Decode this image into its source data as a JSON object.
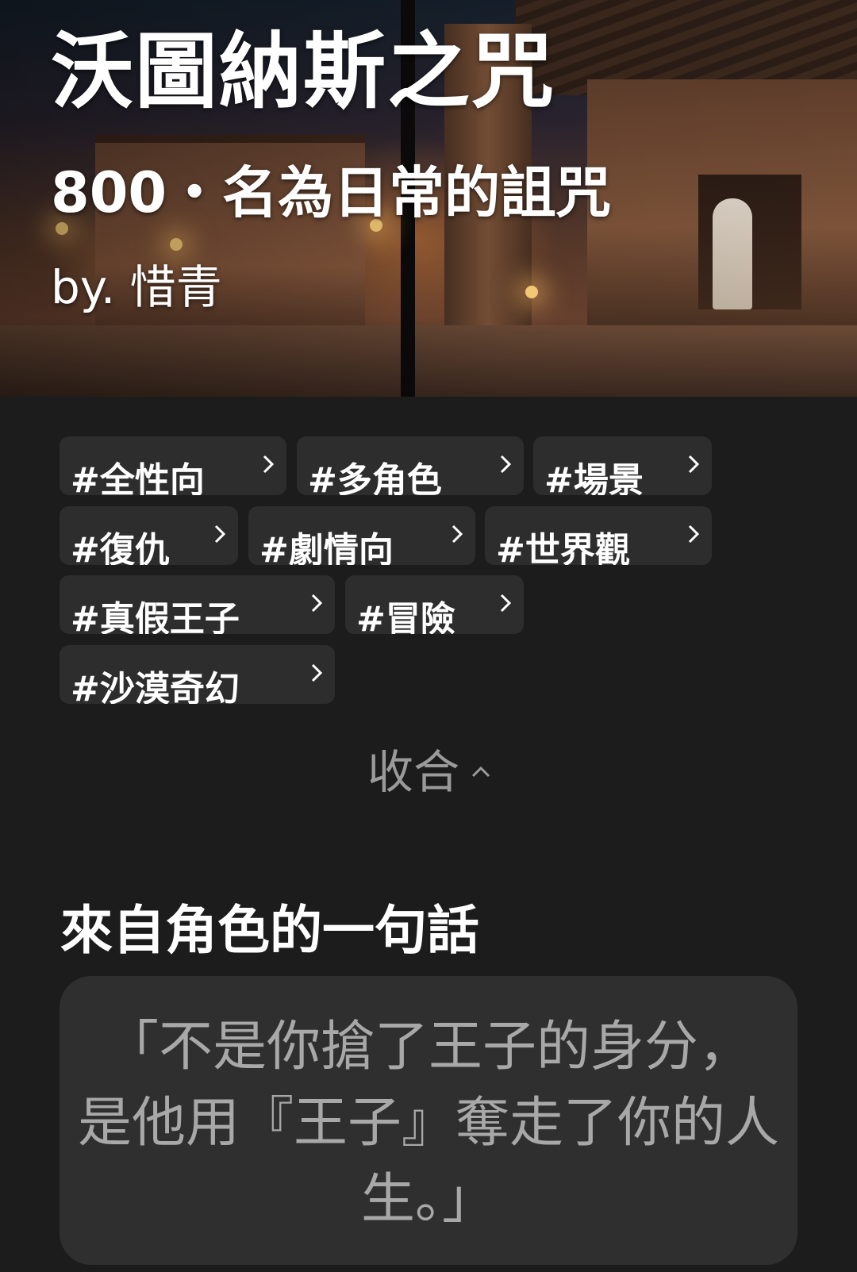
{
  "hero": {
    "title": "沃圖納斯之咒",
    "subtitle": "800・名為日常的詛咒",
    "author": "by. 惜青"
  },
  "tags": [
    {
      "label": "#全性向"
    },
    {
      "label": "#多角色"
    },
    {
      "label": "#場景"
    },
    {
      "label": "#復仇"
    },
    {
      "label": "#劇情向"
    },
    {
      "label": "#世界觀"
    },
    {
      "label": "#真假王子"
    },
    {
      "label": "#冒險"
    },
    {
      "label": "#沙漠奇幻"
    }
  ],
  "collapse": {
    "label": "收合",
    "icon": "chevron-up-icon"
  },
  "character_quote": {
    "heading": "來自角色的一句話",
    "lines": [
      "「不是你搶了王子的身分，",
      "是他用『王子』奪走了你的人",
      "生。」"
    ]
  },
  "colors": {
    "background": "#1c1c1c",
    "tag_background": "#2d2d2d",
    "card_background": "#2f2f2f",
    "quote_text": "#a8a8a8",
    "muted_text": "#9a9a9a"
  }
}
